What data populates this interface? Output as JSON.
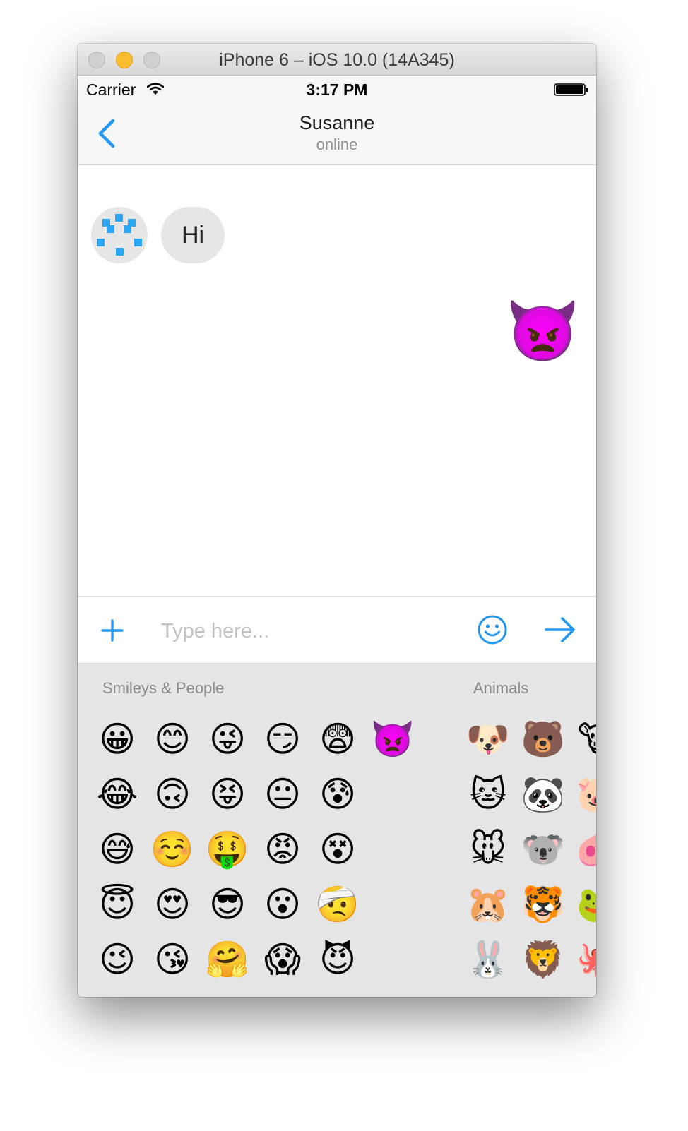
{
  "window": {
    "title": "iPhone 6 – iOS 10.0 (14A345)"
  },
  "status_bar": {
    "carrier": "Carrier",
    "time": "3:17 PM"
  },
  "nav": {
    "contact_name": "Susanne",
    "contact_status": "online"
  },
  "messages": {
    "incoming_text": "Hi",
    "outgoing_emoji": "👿"
  },
  "composer": {
    "placeholder": "Type here..."
  },
  "keyboard": {
    "smileys_label": "Smileys & People",
    "animals_label": "Animals",
    "smileys_columns": [
      [
        "😀",
        "😂",
        "😅",
        "😇",
        "😉"
      ],
      [
        "😊",
        "🙃",
        "☺️",
        "😍",
        "😘"
      ],
      [
        "😜",
        "😝",
        "🤑",
        "😎",
        "🤗"
      ],
      [
        "😏",
        "😐",
        "😡",
        "😮",
        "😱"
      ],
      [
        "😨",
        "😰",
        "😵",
        "🤕",
        "😈"
      ],
      [
        "👿"
      ]
    ],
    "animals_columns": [
      [
        "🐶",
        "🐱",
        "🐭",
        "🐹",
        "🐰"
      ],
      [
        "🐻",
        "🐼",
        "🐨",
        "🐯",
        "🦁"
      ],
      [
        "🐮",
        "🐷",
        "🐽",
        "🐸",
        "🐙"
      ]
    ]
  },
  "colors": {
    "accent": "#2196F3",
    "bubble": "#E6E6E6",
    "keyboard_bg": "#E5E5E5"
  }
}
